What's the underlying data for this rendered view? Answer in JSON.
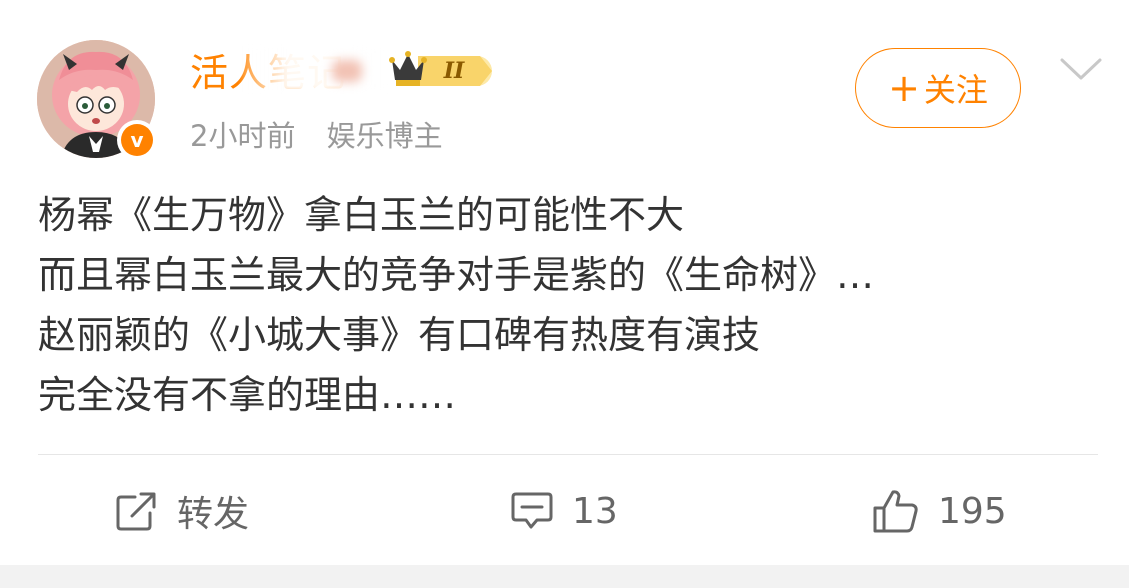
{
  "post": {
    "user": {
      "name": "活人笔记",
      "time": "2小时前",
      "category": "娱乐博主",
      "verified_symbol": "v",
      "level_badge": "II"
    },
    "follow_label": "关注",
    "follow_plus": "+",
    "content_lines": [
      "杨幂《生万物》拿白玉兰的可能性不大",
      "而且幂白玉兰最大的竞争对手是紫的《生命树》…",
      "赵丽颖的《小城大事》有口碑有热度有演技",
      "完全没有不拿的理由……"
    ],
    "actions": {
      "repost_label": "转发",
      "comment_count": "13",
      "like_count": "195"
    },
    "colors": {
      "accent": "#ff8200",
      "text": "#333333",
      "muted": "#999999"
    },
    "icons": [
      "avatar",
      "verified-icon",
      "crown-level-badge",
      "chevron-down-icon",
      "repost-icon",
      "comment-icon",
      "like-icon"
    ]
  }
}
